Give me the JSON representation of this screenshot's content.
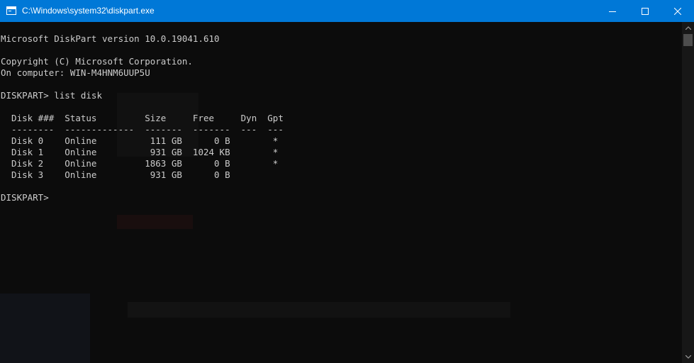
{
  "window": {
    "title": "C:\\Windows\\system32\\diskpart.exe",
    "icon": "console-app-icon",
    "controls": [
      "minimize-icon",
      "maximize-icon",
      "close-icon"
    ]
  },
  "console": {
    "lines": [
      "Microsoft DiskPart version 10.0.19041.610",
      "",
      "Copyright (C) Microsoft Corporation.",
      "On computer: WIN-M4HNM6UUP5U",
      "",
      "DISKPART> list disk",
      "",
      "  Disk ###  Status         Size     Free     Dyn  Gpt",
      "  --------  -------------  -------  -------  ---  ---",
      "  Disk 0    Online          111 GB      0 B        *",
      "  Disk 1    Online          931 GB  1024 KB        *",
      "  Disk 2    Online         1863 GB      0 B        *",
      "  Disk 3    Online          931 GB      0 B",
      "",
      "DISKPART> "
    ]
  },
  "colors": {
    "titlebar": "#0078d7",
    "console_bg": "#0c0c0c",
    "console_fg": "#cccccc"
  }
}
